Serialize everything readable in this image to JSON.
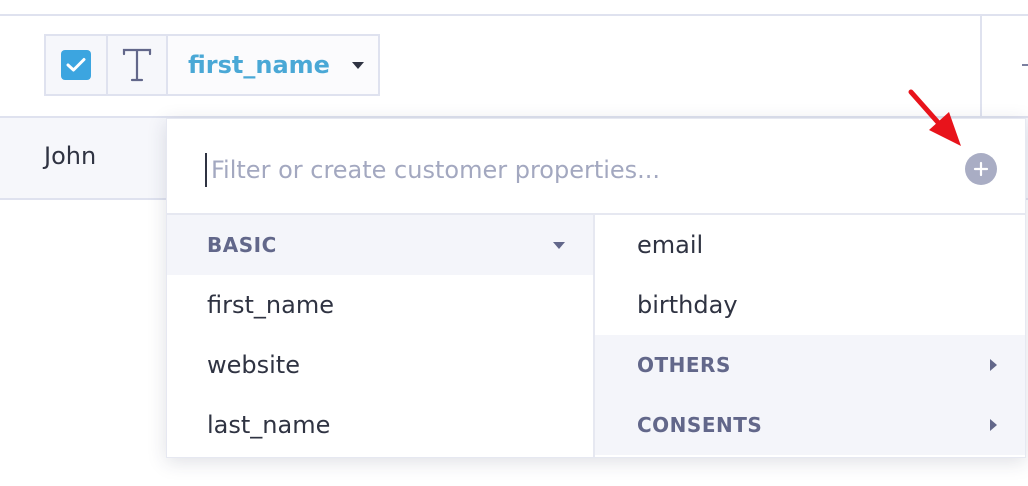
{
  "column_header": {
    "name": "first_name",
    "type_icon": "text-type-icon",
    "checked": true
  },
  "row": {
    "first_value": "John"
  },
  "dropdown": {
    "filter_placeholder": "Filter or create customer properties...",
    "filter_value": "",
    "add_icon": "plus-circle-icon",
    "left_column": {
      "section_label": "BASIC",
      "items": [
        "first_name",
        "website",
        "last_name"
      ]
    },
    "right_column": {
      "items": [
        "email",
        "birthday"
      ],
      "sections": [
        {
          "label": "OTHERS"
        },
        {
          "label": "CONSENTS"
        }
      ]
    }
  },
  "colors": {
    "accent": "#3ca5e0",
    "column_name": "#4aa8d6",
    "section_label": "#62678a",
    "annotation_arrow": "#e8131b"
  }
}
